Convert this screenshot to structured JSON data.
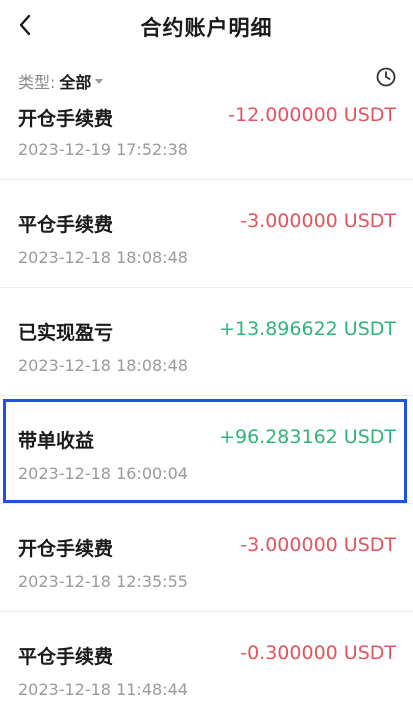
{
  "header": {
    "title": "合约账户明细"
  },
  "filter": {
    "label": "类型:",
    "value": "全部"
  },
  "colors": {
    "negative": "#e2545f",
    "positive": "#2fb57a",
    "highlight": "#1f52e0"
  },
  "records": [
    {
      "type": "开仓手续费",
      "amount": "-12.000000 USDT",
      "time": "2023-12-19 17:52:38",
      "sign": "neg"
    },
    {
      "type": "平仓手续费",
      "amount": "-3.000000 USDT",
      "time": "2023-12-18 18:08:48",
      "sign": "neg"
    },
    {
      "type": "已实现盈亏",
      "amount": "+13.896622 USDT",
      "time": "2023-12-18 18:08:48",
      "sign": "pos"
    },
    {
      "type": "带单收益",
      "amount": "+96.283162 USDT",
      "time": "2023-12-18 16:00:04",
      "sign": "pos"
    },
    {
      "type": "开仓手续费",
      "amount": "-3.000000 USDT",
      "time": "2023-12-18 12:35:55",
      "sign": "neg"
    },
    {
      "type": "平仓手续费",
      "amount": "-0.300000 USDT",
      "time": "2023-12-18 11:48:44",
      "sign": "neg"
    }
  ]
}
